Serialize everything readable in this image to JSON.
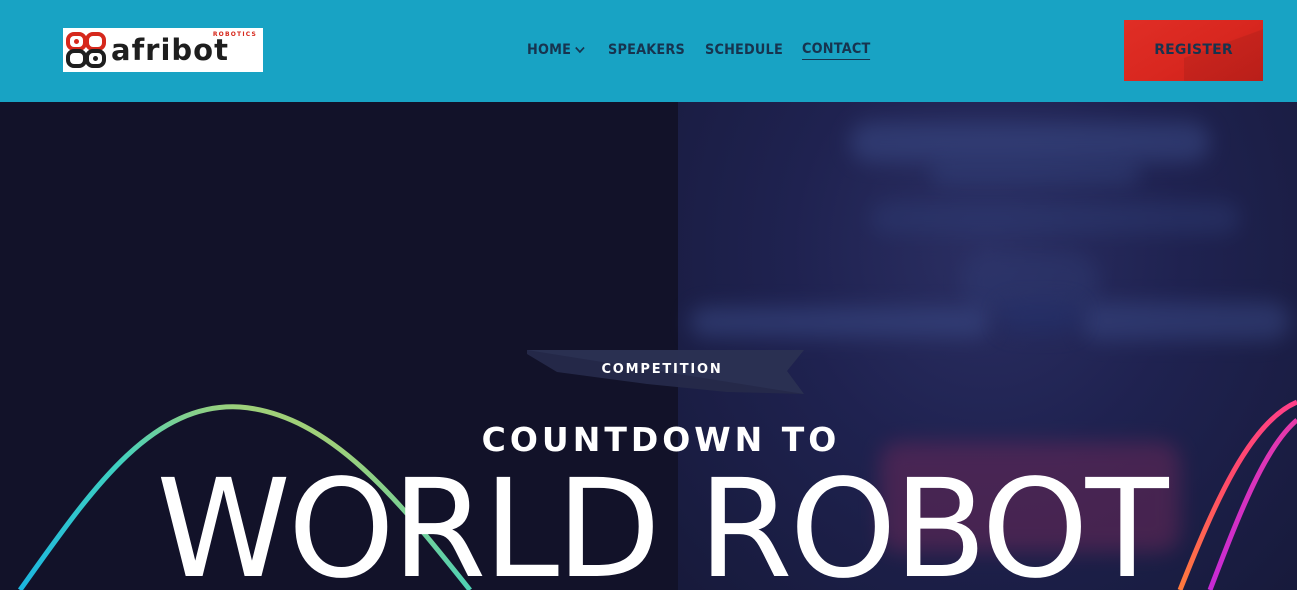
{
  "header": {
    "logo": {
      "text": "afribot",
      "subtext": "ROBOTICS",
      "colors": {
        "red": "#d6281c",
        "dark": "#1e1e1e"
      }
    },
    "nav": [
      {
        "label": "HOME",
        "has_dropdown": true,
        "icon": "chevron-down-icon"
      },
      {
        "label": "SPEAKERS"
      },
      {
        "label": "SCHEDULE"
      },
      {
        "label": "CONTACT",
        "active": true
      }
    ],
    "register_label": "REGISTER",
    "colors": {
      "background": "#18a3c4",
      "nav_text": "#17344f",
      "register": "#d8271f"
    }
  },
  "hero": {
    "badge": "COMPETITION",
    "pre_title": "COUNTDOWN TO",
    "title": "WORLD ROBOT",
    "colors": {
      "background": "#13132b",
      "text": "#ffffff"
    }
  }
}
